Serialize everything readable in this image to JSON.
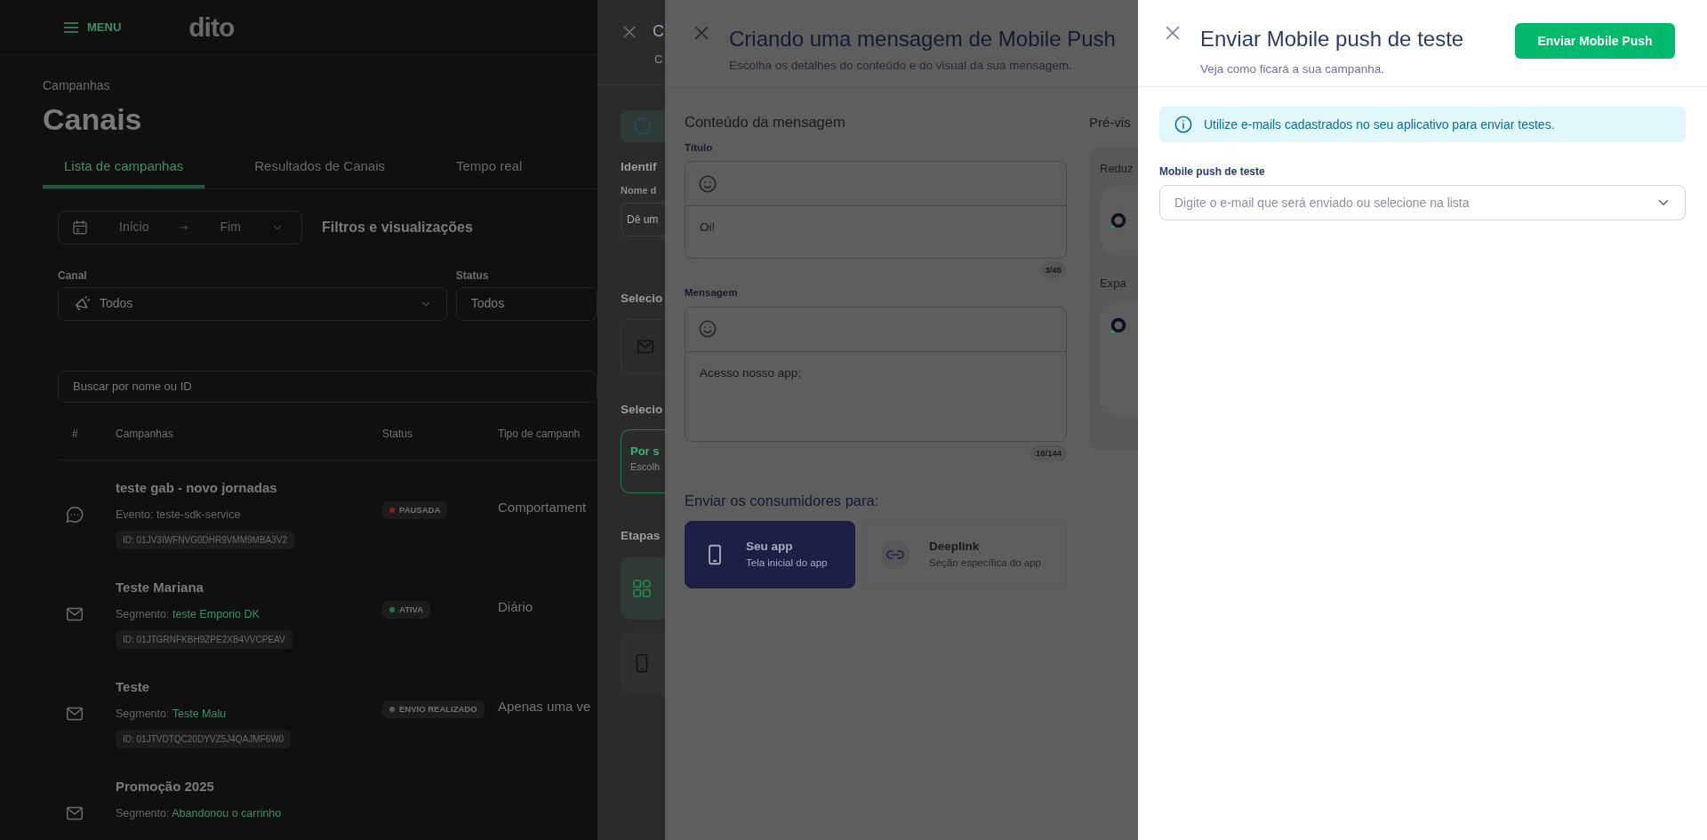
{
  "background_page": {
    "menu_label": "MENU",
    "logo": "dito",
    "breadcrumb": "Campanhas",
    "title": "Canais",
    "tabs": [
      {
        "label": "Lista de campanhas",
        "selected": true
      },
      {
        "label": "Resultados de Canais",
        "selected": false
      },
      {
        "label": "Tempo real",
        "selected": false
      }
    ],
    "date_range": {
      "start_placeholder": "Início",
      "end_placeholder": "Fim"
    },
    "filters_label": "Filtros e visualizações",
    "channel_filter": {
      "label": "Canal",
      "value": "Todos"
    },
    "status_filter": {
      "label": "Status",
      "value": "Todos"
    },
    "search": {
      "placeholder": "Buscar por nome ou ID"
    },
    "table": {
      "columns": [
        "#",
        "Campanhas",
        "Status",
        "Tipo de campanh"
      ],
      "rows": [
        {
          "kind": "chat",
          "name": "teste gab - novo jornadas",
          "target_label": "Evento:",
          "target": "teste-sdk-service",
          "target_link": false,
          "id": "ID: 01JV3IWFNVG0DHR9VMM9MBA3V2",
          "status": "PAUSADA",
          "color": "#8a2222",
          "type": "Comportament"
        },
        {
          "kind": "mail",
          "name": "Teste Mariana",
          "target_label": "Segmento:",
          "target": "teste Emporio DK",
          "target_link": true,
          "id": "ID: 01JTGRNFKBH9ZPE2XB4VVCPEAV",
          "status": "ATIVA",
          "color": "#1c7a4c",
          "type": "Diário"
        },
        {
          "kind": "mail",
          "name": "Teste",
          "target_label": "Segmento:",
          "target": "Teste Malu",
          "target_link": true,
          "id": "ID: 01JTVDTQC20DYVZ5J4QAJMF6W0",
          "status": "ENVIO REALIZADO",
          "color": "#5a5a5a",
          "type": "Apenas uma ve"
        },
        {
          "kind": "mail",
          "name": "Promoção 2025",
          "target_label": "Segmento:",
          "target": "Abandonou o carrinho",
          "target_link": true
        }
      ]
    }
  },
  "create_drawer": {
    "title": "C",
    "subtitle": "C",
    "section_1": "Identif",
    "name_label": "Nome d",
    "name_placeholder": "Dê um",
    "section_2": "Selecio",
    "section_3": "Selecio",
    "option": {
      "title": "Por s",
      "description": "Escolh",
      "selected": true
    },
    "section_4": "Etapas",
    "steps": [
      {
        "selected": true
      },
      {
        "selected": false
      }
    ]
  },
  "message_drawer": {
    "title": "Criando uma mensagem de Mobile Push",
    "subtitle": "Escolha os detalhes do conteúdo e do visual da sua mensagem.",
    "content_heading": "Conteúdo da mensagem",
    "title_field": {
      "label": "Título",
      "value": "Oi!",
      "counter": "3/45"
    },
    "message_field": {
      "label": "Mensagem",
      "value": "Acesso nosso app;",
      "counter": "18/144"
    },
    "destination_heading": "Enviar os consumidores para:",
    "destinations": [
      {
        "kind": "app",
        "title": "Seu app",
        "description": "Tela inicial do app",
        "selected": true
      },
      {
        "kind": "link",
        "title": "Deeplink",
        "description": "Seção específica do app",
        "selected": false
      }
    ],
    "preview": {
      "heading": "Pré-vis",
      "collapsed_label": "Reduz",
      "expanded_label": "Expa"
    }
  },
  "test_drawer": {
    "title": "Enviar Mobile push de teste",
    "subtitle": "Veja como ficará a sua campanha.",
    "send_button": "Enviar Mobile Push",
    "alert": "Utilize e-mails cadastrados no seu aplicativo para enviar testes.",
    "recipient_field": {
      "label": "Mobile push de teste",
      "placeholder": "Digite o e-mail que será enviado ou selecione na lista"
    }
  }
}
